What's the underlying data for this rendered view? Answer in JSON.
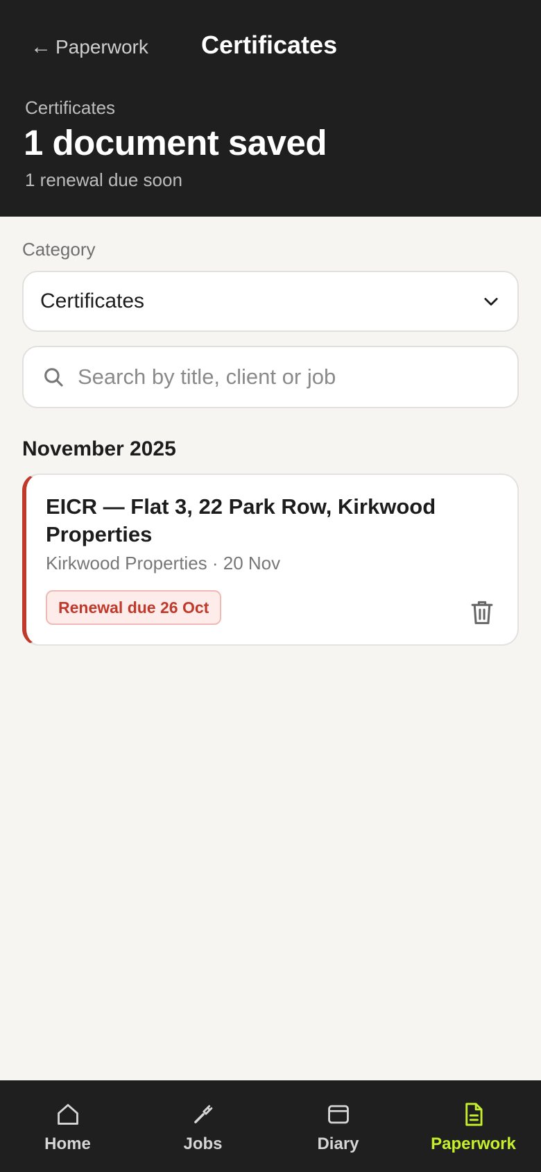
{
  "header": {
    "back_label": "Paperwork",
    "back_arrow": "←",
    "title": "Certificates",
    "eyebrow": "Certificates",
    "headline": "1 document saved",
    "subline": "1 renewal due soon"
  },
  "filters": {
    "category_label": "Category",
    "category_value": "Certificates",
    "search_placeholder": "Search by title, client or job",
    "search_value": ""
  },
  "sections": [
    {
      "title": "November 2025",
      "documents": [
        {
          "title": "EICR — Flat 3, 22 Park Row, Kirkwood Properties",
          "meta": "Kirkwood Properties · 20 Nov",
          "badge": "Renewal due 26 Oct",
          "status_color": "#c0392b"
        }
      ]
    }
  ],
  "nav": {
    "items": [
      {
        "label": "Home",
        "icon": "home-icon"
      },
      {
        "label": "Jobs",
        "icon": "wrench-icon"
      },
      {
        "label": "Diary",
        "icon": "calendar-icon"
      },
      {
        "label": "Paperwork",
        "icon": "document-icon",
        "active": true
      }
    ],
    "active_color": "#c6f02c"
  },
  "colors": {
    "header_bg": "#1f1f1f",
    "page_bg": "#f6f5f2",
    "accent": "#c6f02c",
    "alert": "#c0392b"
  }
}
